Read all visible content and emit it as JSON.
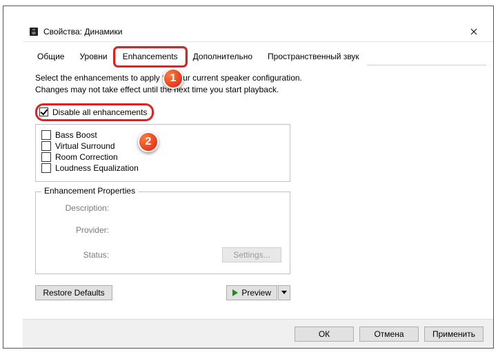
{
  "window": {
    "title": "Свойства: Динамики",
    "close": "Close"
  },
  "tabs": {
    "items": [
      {
        "label": "Общие"
      },
      {
        "label": "Уровни"
      },
      {
        "label": "Enhancements"
      },
      {
        "label": "Дополнительно"
      },
      {
        "label": "Пространственный звук"
      }
    ],
    "active_index": 2
  },
  "content": {
    "instruction": "Select the enhancements to apply for your current speaker configuration. Changes may not take effect until the next time you start playback.",
    "disable_all": {
      "label": "Disable all enhancements",
      "checked": true
    },
    "list": [
      {
        "label": "Bass Boost",
        "checked": false
      },
      {
        "label": "Virtual Surround",
        "checked": false
      },
      {
        "label": "Room Correction",
        "checked": false
      },
      {
        "label": "Loudness Equalization",
        "checked": false
      }
    ],
    "properties": {
      "legend": "Enhancement Properties",
      "description_label": "Description:",
      "provider_label": "Provider:",
      "status_label": "Status:",
      "settings_btn": "Settings..."
    },
    "restore": "Restore Defaults",
    "preview": "Preview"
  },
  "footer": {
    "ok": "ОК",
    "cancel": "Отмена",
    "apply": "Применить"
  },
  "callouts": {
    "one": "1",
    "two": "2"
  }
}
